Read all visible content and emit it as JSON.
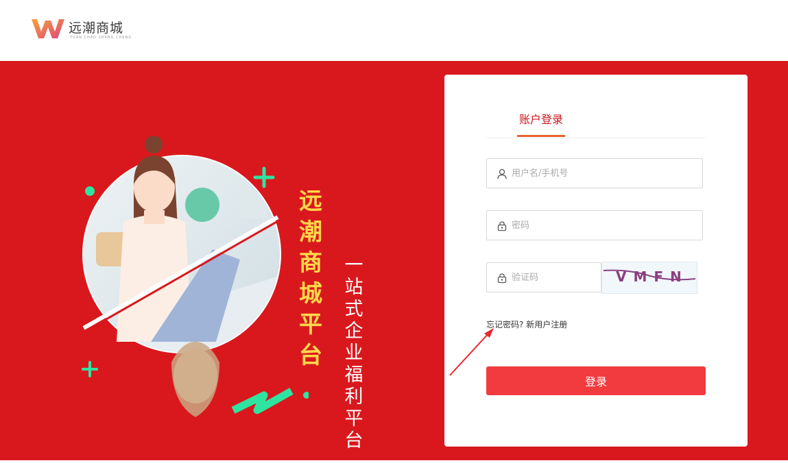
{
  "header": {
    "logo_text": "远潮商城",
    "logo_subtext": "YUAN CHAO SHANG CHENG"
  },
  "banner": {
    "title_chars": [
      "远",
      "潮",
      "商",
      "城",
      "平",
      "台"
    ],
    "subtitle_chars": [
      "一",
      "站",
      "式",
      "企",
      "业",
      "福",
      "利",
      "平",
      "台"
    ],
    "background_color": "#d9181d",
    "title_color": "#ffd84a"
  },
  "login": {
    "tab_label": "账户登录",
    "username_placeholder": "用户名/手机号",
    "password_placeholder": "密码",
    "captcha_placeholder": "验证码",
    "captcha_text": "VMFN",
    "forgot_label": "忘记密码?",
    "register_label": "新用户注册",
    "submit_label": "登录",
    "accent_color": "#f13b3f"
  }
}
